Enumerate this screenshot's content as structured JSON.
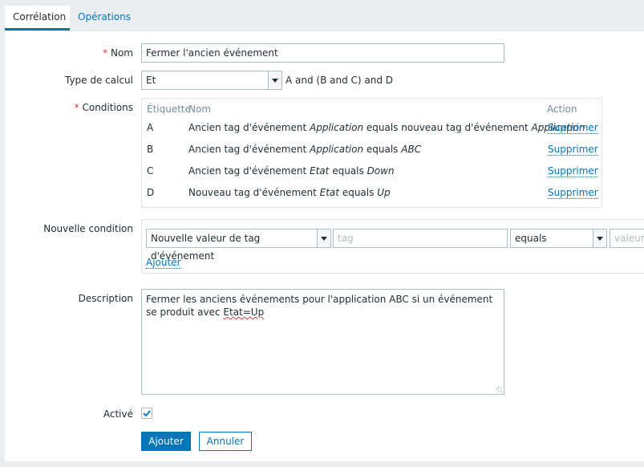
{
  "tabs": [
    {
      "label": "Corrélation",
      "active": true
    },
    {
      "label": "Opérations",
      "active": false
    }
  ],
  "form": {
    "name": {
      "label": "Nom",
      "value": "Fermer l'ancien événement",
      "required_mark": "*"
    },
    "calc_type": {
      "label": "Type de calcul",
      "value": "Et",
      "formula": "A and (B and C) and D"
    },
    "conditions": {
      "label": "Conditions",
      "required_mark": "*",
      "headers": {
        "tag": "Étiquette",
        "name": "Nom",
        "action": "Action"
      },
      "rows": [
        {
          "tag": "A",
          "text_1": "Ancien tag d'événement ",
          "italic_1": "Application",
          "text_2": " equals nouveau tag d'événement ",
          "italic_2": "Application",
          "action": "Supprimer"
        },
        {
          "tag": "B",
          "text_1": "Ancien tag d'événement ",
          "italic_1": "Application",
          "text_2": " equals ",
          "italic_2": "ABC",
          "action": "Supprimer"
        },
        {
          "tag": "C",
          "text_1": "Ancien tag d'événement ",
          "italic_1": "Etat",
          "text_2": " equals ",
          "italic_2": "Down",
          "action": "Supprimer"
        },
        {
          "tag": "D",
          "text_1": "Nouveau tag d'événement ",
          "italic_1": "Etat",
          "text_2": " equals ",
          "italic_2": "Up",
          "action": "Supprimer"
        }
      ]
    },
    "new_condition": {
      "label": "Nouvelle condition",
      "type_value": "Nouvelle valeur de tag d'événement",
      "tag_placeholder": "tag",
      "operator_value": "equals",
      "value_placeholder": "valeur",
      "add_link": "Ajouter"
    },
    "description": {
      "label": "Description",
      "value_1": "Fermer les anciens événements pour l'application ABC si un événement se produit avec ",
      "value_misspelled": "Etat=Up"
    },
    "enabled": {
      "label": "Activé",
      "checked": true
    },
    "buttons": {
      "add": "Ajouter",
      "cancel": "Annuler"
    }
  },
  "colors": {
    "accent": "#0275b8",
    "required": "#e33734",
    "muted": "#768d99"
  }
}
